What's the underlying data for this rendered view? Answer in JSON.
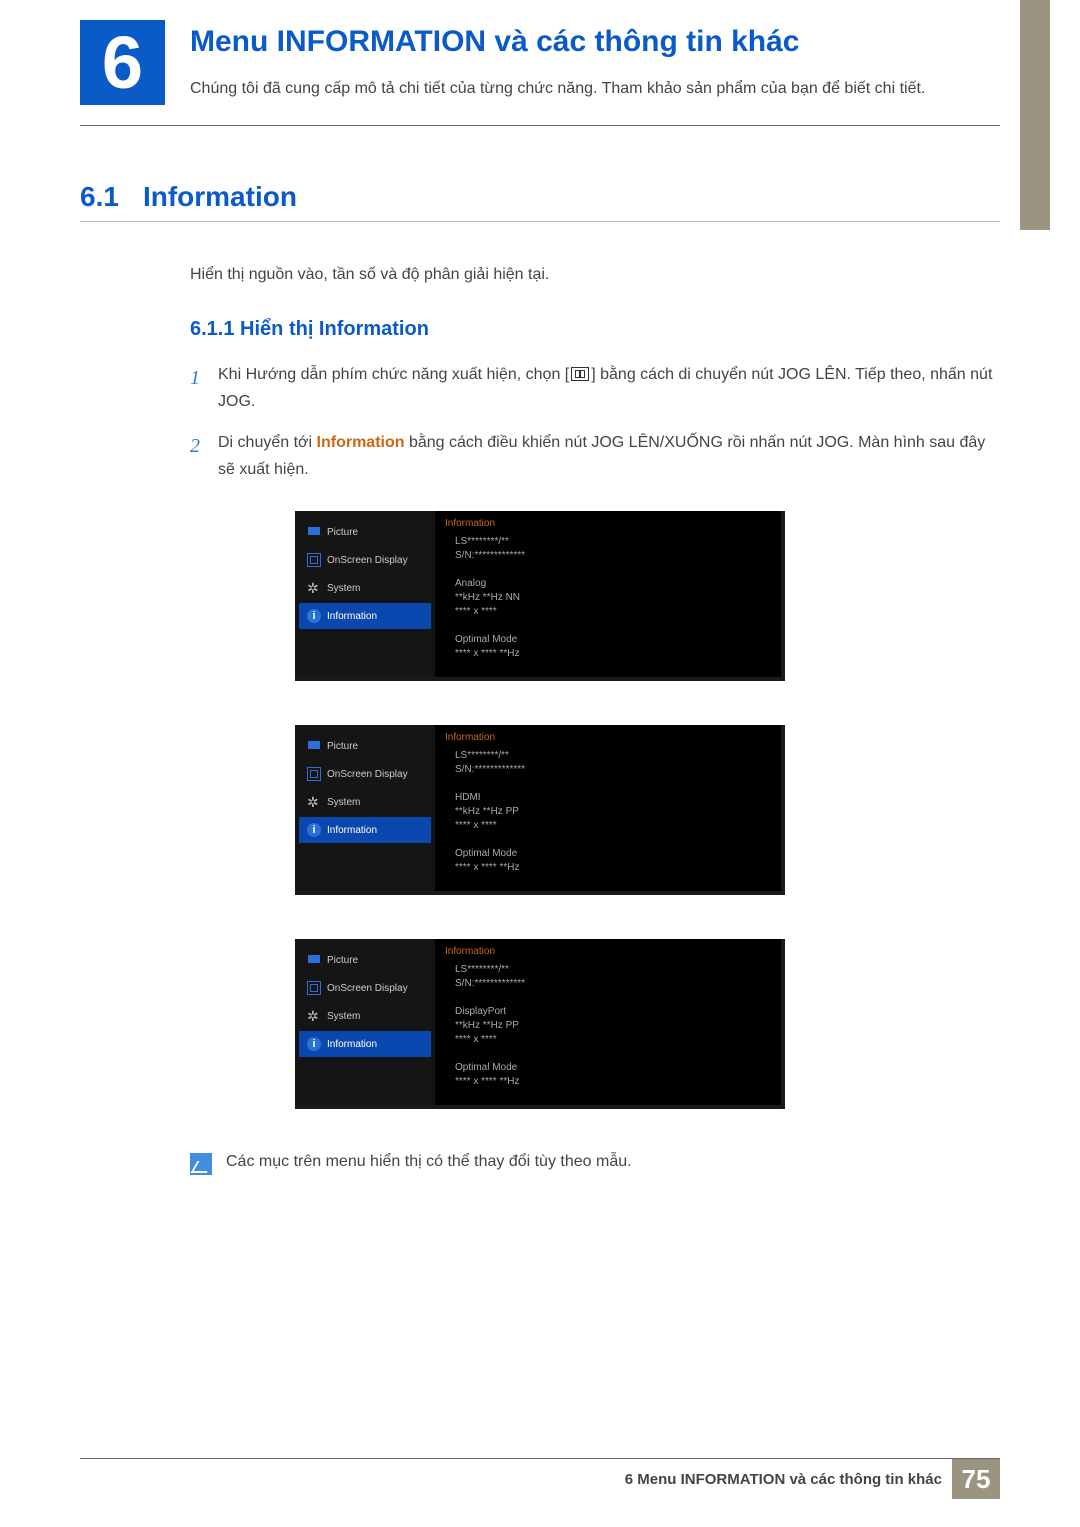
{
  "chapter": {
    "number": "6",
    "title": "Menu INFORMATION và các thông tin khác",
    "subtitle": "Chúng tôi đã cung cấp mô tả chi tiết của từng chức năng. Tham khảo sản phẩm của bạn để biết chi tiết."
  },
  "section": {
    "num": "6.1",
    "title": "Information",
    "desc": "Hiển thị nguồn vào, tần số và độ phân giải hiện tại."
  },
  "subsection": {
    "num": "6.1.1",
    "title": "Hiển thị Information"
  },
  "steps": [
    {
      "num": "1",
      "pre": "Khi Hướng dẫn phím chức năng xuất hiện, chọn [",
      "post": "] bằng cách di chuyển nút JOG LÊN. Tiếp theo, nhấn nút JOG."
    },
    {
      "num": "2",
      "pre": "Di chuyển tới ",
      "strong": "Information",
      "post": " bằng cách điều khiển nút JOG LÊN/XUỐNG rồi nhấn nút JOG. Màn hình sau đây sẽ xuất hiện."
    }
  ],
  "osd": {
    "menu": [
      "Picture",
      "OnScreen Display",
      "System",
      "Information"
    ],
    "title": "Information",
    "panels": [
      "LS********/**\nS/N:*************\n\nAnalog\n**kHz **Hz NN\n**** x ****\n\nOptimal Mode\n**** x **** **Hz",
      "LS********/**\nS/N:*************\n\nHDMI\n**kHz **Hz PP\n**** x ****\n\nOptimal Mode\n**** x **** **Hz",
      "LS********/**\nS/N:*************\n\nDisplayPort\n**kHz **Hz PP\n**** x ****\n\nOptimal Mode\n**** x **** **Hz"
    ]
  },
  "note": "Các mục trên menu hiển thị có thể thay đổi tùy theo mẫu.",
  "footer": {
    "text": "6 Menu INFORMATION và các thông tin khác",
    "page": "75"
  }
}
